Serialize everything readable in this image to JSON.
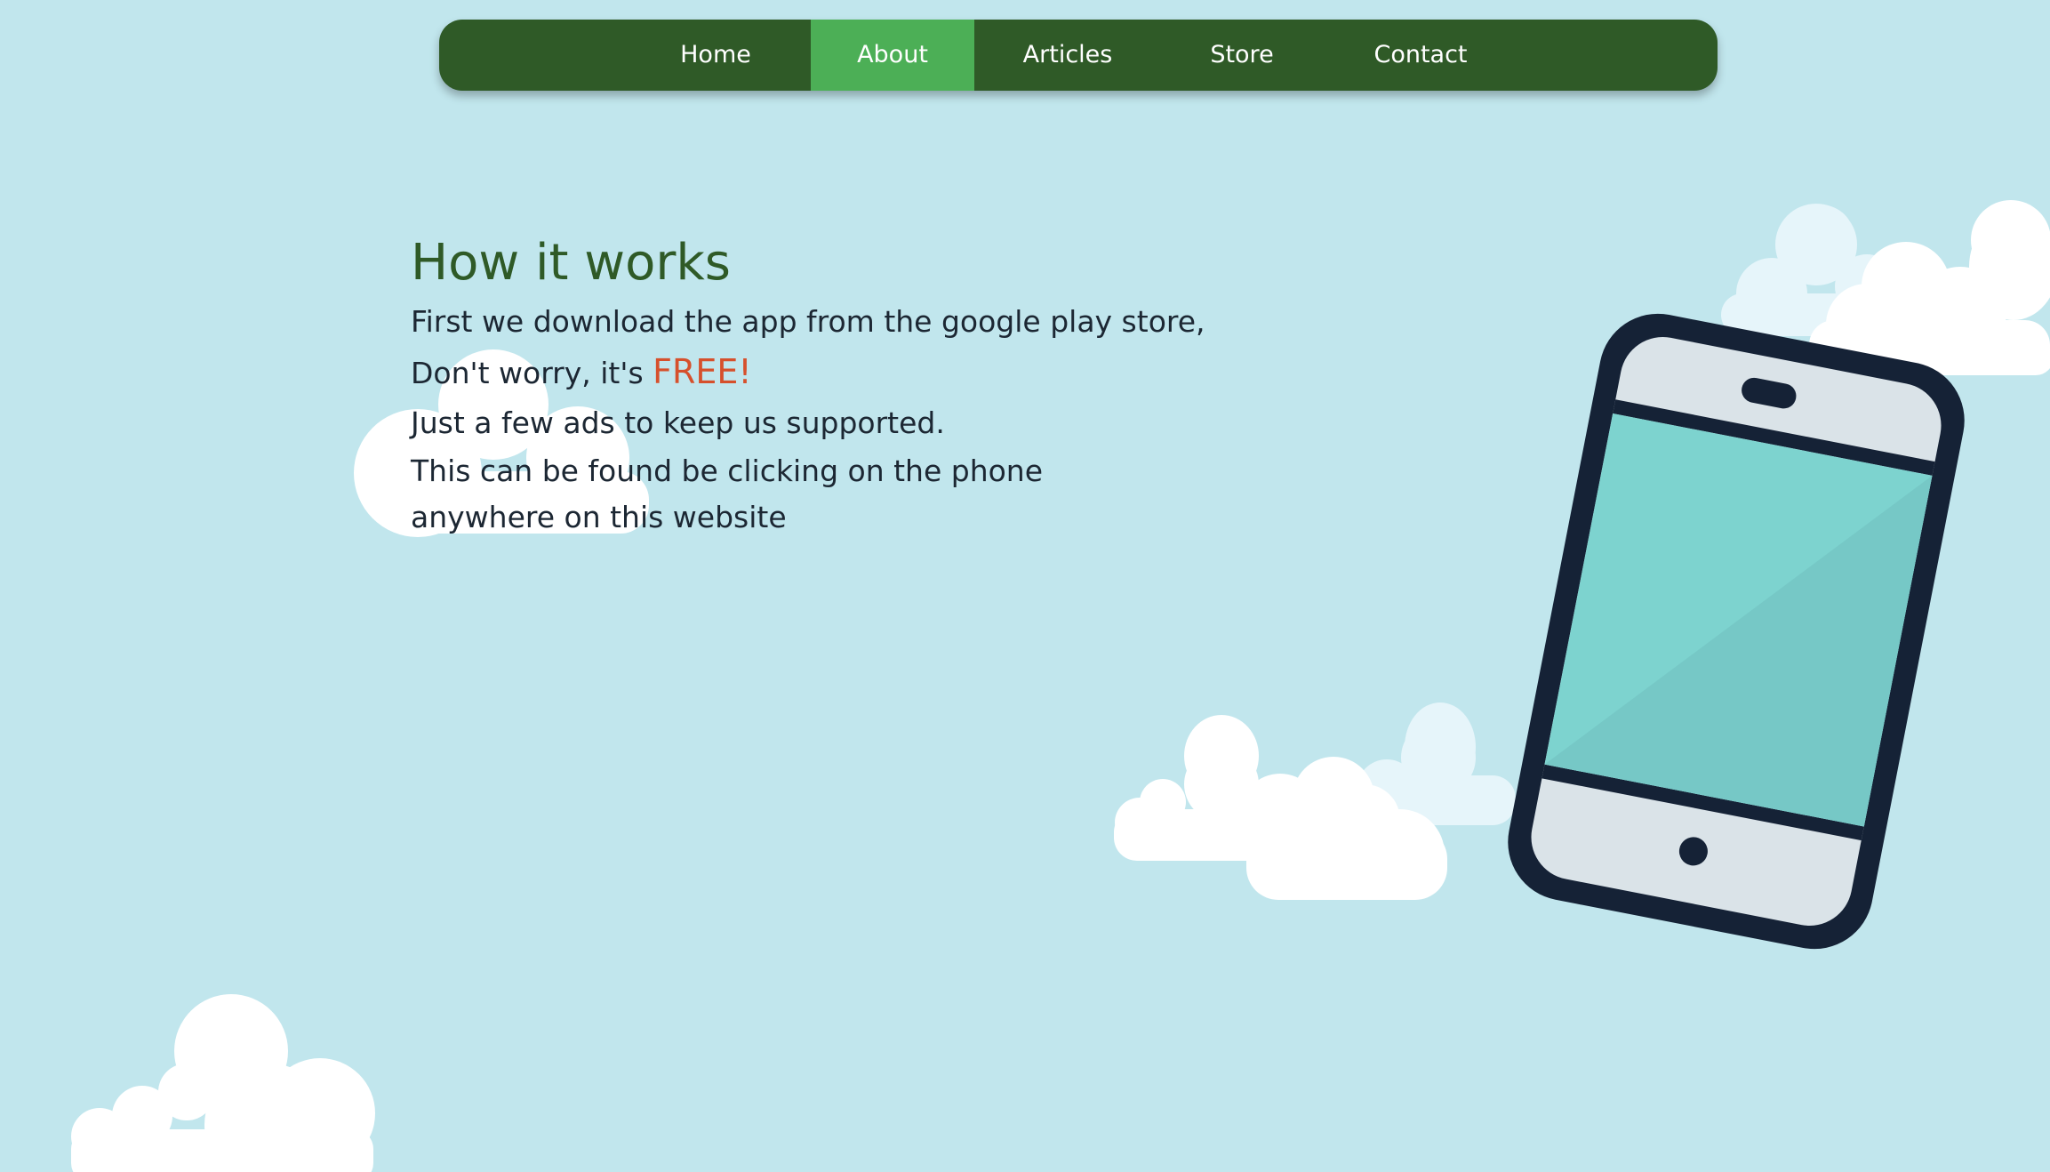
{
  "nav": {
    "items": [
      {
        "label": "Home"
      },
      {
        "label": "About"
      },
      {
        "label": "Articles"
      },
      {
        "label": "Store"
      },
      {
        "label": "Contact"
      }
    ],
    "active": "About"
  },
  "main": {
    "title": "How it works",
    "line1": "First we download the app from the google play store,",
    "line2_prefix": "Don't worry, it's ",
    "line2_highlight": "FREE!",
    "line3": "Just a few ads to keep us supported.",
    "line4": "This can be found be clicking on the phone",
    "line5": "anywhere on this website"
  },
  "icons": {
    "phone": "phone-icon",
    "cloud": "cloud-icon"
  },
  "colors": {
    "background": "#c1e6ed",
    "nav_bg": "#2f5a27",
    "nav_active": "#4caf56",
    "heading": "#2f5a27",
    "text": "#1c2733",
    "highlight": "#d6502c",
    "phone_frame": "#152236",
    "phone_screen": "#7dd3cf"
  }
}
